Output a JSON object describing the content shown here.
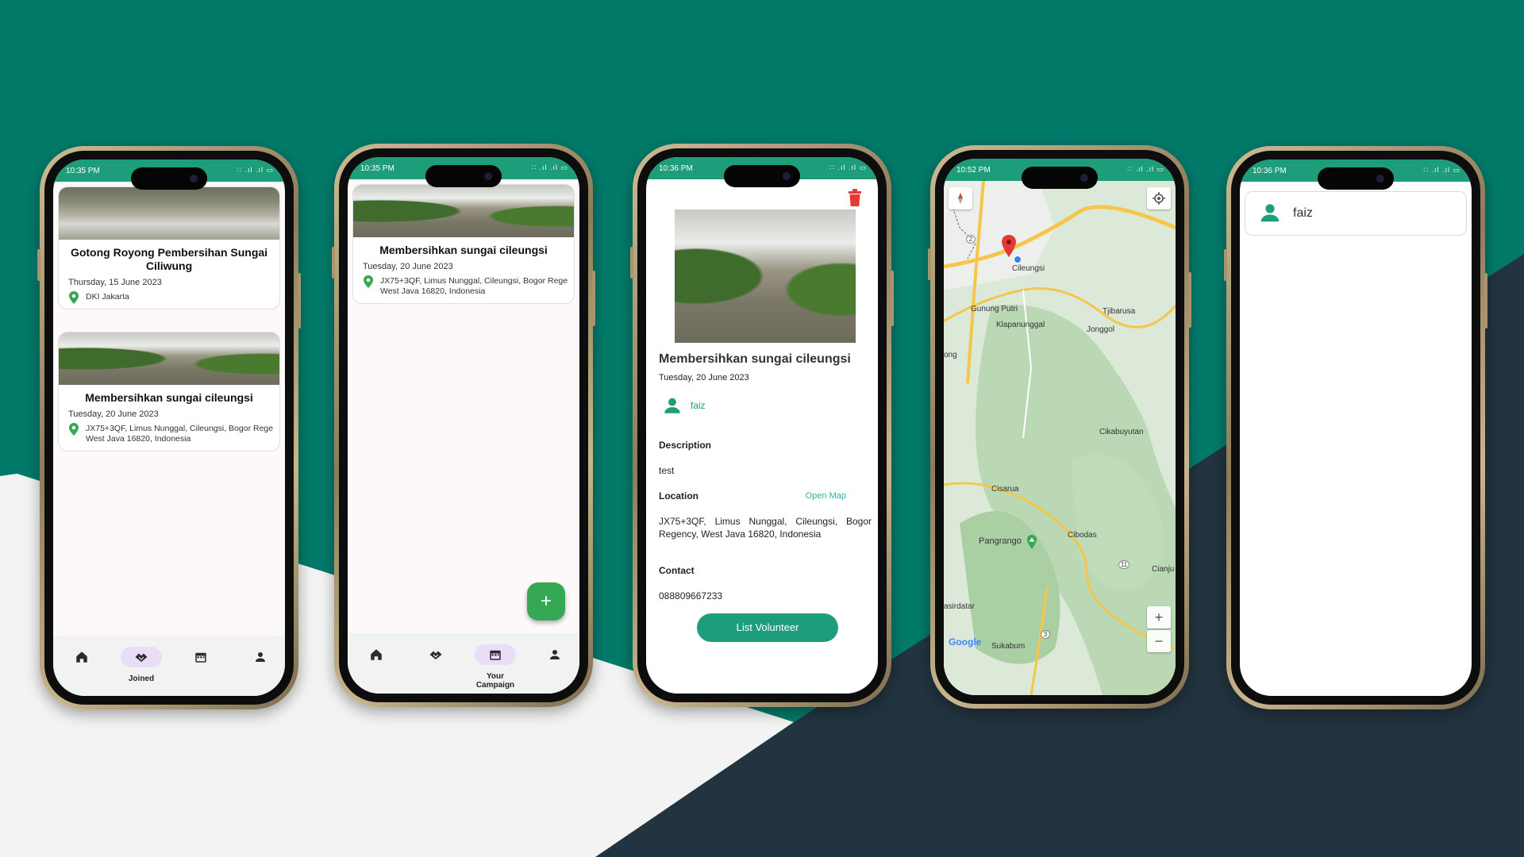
{
  "colors": {
    "teal": "#027a6a",
    "dark": "#22343f",
    "light": "#f2f3f2",
    "accent": "#1e9d7a",
    "fab": "#34a853",
    "delete": "#e53935"
  },
  "status_icons": "∷ .ıl .ıl ▭",
  "phone1": {
    "time": "10:35 PM",
    "cards": [
      {
        "title": "Gotong Royong Pembersihan Sungai Ciliwung",
        "date": "Thursday, 15 June 2023",
        "location": "DKI Jakarta"
      },
      {
        "title": "Membersihkan sungai cileungsi",
        "date": "Tuesday, 20 June 2023",
        "location_line1": "JX75+3QF, Limus Nunggal, Cileungsi, Bogor Rege",
        "location_line2": "West Java 16820, Indonesia"
      }
    ],
    "nav": {
      "active_label": "Joined",
      "icons": [
        "home-icon",
        "handshake-icon",
        "calendar-icon",
        "person-icon"
      ]
    }
  },
  "phone2": {
    "time": "10:35 PM",
    "card": {
      "title": "Membersihkan sungai cileungsi",
      "date": "Tuesday, 20 June 2023",
      "location_line1": "JX75+3QF, Limus Nunggal, Cileungsi, Bogor Rege",
      "location_line2": "West Java 16820, Indonesia"
    },
    "fab_label": "+",
    "nav": {
      "active_label": "Your Campaign",
      "icons": [
        "home-icon",
        "handshake-icon",
        "calendar-icon",
        "person-icon"
      ]
    }
  },
  "phone3": {
    "time": "10:36 PM",
    "title": "Membersihkan sungai cileungsi",
    "date": "Tuesday, 20 June 2023",
    "organizer": "faiz",
    "description_label": "Description",
    "description": "test",
    "location_label": "Location",
    "open_map": "Open Map",
    "location": "JX75+3QF, Limus Nunggal, Cileungsi, Bogor Regency, West Java 16820, Indonesia",
    "contact_label": "Contact",
    "contact": "088809667233",
    "button": "List Volunteer"
  },
  "phone4": {
    "time": "10:52 PM",
    "labels": {
      "cileungsi": "Cileungsi",
      "gunung_putri": "Gunung Putri",
      "klapanunggal": "Klapanunggal",
      "tjibarusa": "Tjibarusa",
      "jonggol": "Jonggol",
      "ong": "ong",
      "cikabuyutan": "Cikabuyutan",
      "cisarua": "Cisarua",
      "pangrango": "Pangrango",
      "cibodas": "Cibodas",
      "cianju": "Cianju",
      "asirdatar": "asirdatar",
      "google": "Google",
      "sukabum": "Sukabum"
    },
    "road_numbers": {
      "r2": "2",
      "r11": "11",
      "r3": "3"
    },
    "zoom_in": "+",
    "zoom_out": "−"
  },
  "phone5": {
    "time": "10:36 PM",
    "username": "faiz"
  }
}
